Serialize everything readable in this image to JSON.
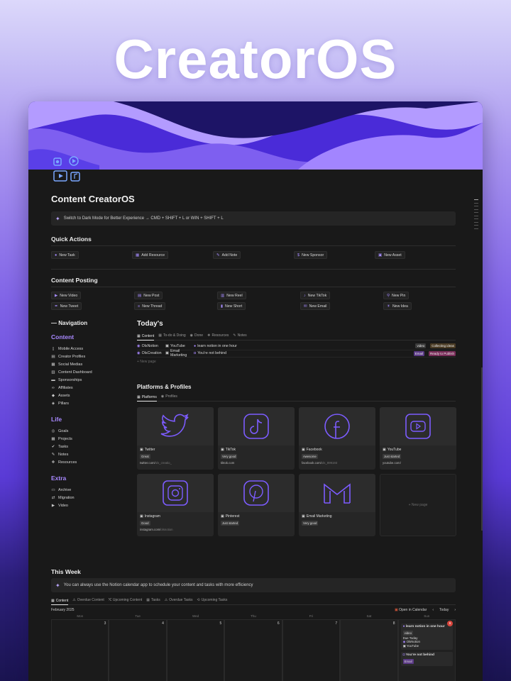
{
  "hero": {
    "title": "CreatorOS"
  },
  "page": {
    "title": "Content CreatorOS",
    "callout": "Switch to Dark Mode for Better Experience → CMD + SHIFT + L or WIN + SHIFT + L"
  },
  "quick_actions": {
    "heading": "Quick Actions",
    "items": [
      {
        "label": "New Task",
        "icon": "check-circle-icon"
      },
      {
        "label": "Add Resource",
        "icon": "grid-icon"
      },
      {
        "label": "Add Note",
        "icon": "pencil-icon"
      },
      {
        "label": "New Sponsor",
        "icon": "dollar-icon"
      },
      {
        "label": "New Asset",
        "icon": "image-icon"
      }
    ]
  },
  "content_posting": {
    "heading": "Content Posting",
    "items": [
      {
        "label": "New Video"
      },
      {
        "label": "New Post"
      },
      {
        "label": "New Reel"
      },
      {
        "label": "New TikTok"
      },
      {
        "label": "New Pin"
      },
      {
        "label": "New Tweet"
      },
      {
        "label": "New Thread"
      },
      {
        "label": "New Short"
      },
      {
        "label": "New Email"
      },
      {
        "label": "New Idea"
      }
    ]
  },
  "navigation": {
    "heading": "— Navigation",
    "sections": [
      {
        "title": "Content",
        "items": [
          "Mobile Access",
          "Creator Profiles",
          "Social Medias",
          "Content Dashboard",
          "Sponsorships",
          "Affiliates",
          "Assets",
          "Pillars"
        ]
      },
      {
        "title": "Life",
        "items": [
          "Goals",
          "Projects",
          "Tasks",
          "Notes",
          "Resources"
        ]
      },
      {
        "title": "Extra",
        "items": [
          "Archive",
          "Migration",
          "Video"
        ]
      }
    ]
  },
  "today": {
    "heading": "Today's",
    "tabs": [
      "Content",
      "To-do & Doing",
      "Done",
      "Resources",
      "Notes"
    ],
    "rows": [
      {
        "who": "OlsNotion",
        "platform": "YouTube",
        "title": "learn notion in one hour",
        "tags": [
          "video",
          "Collecting ideas"
        ]
      },
      {
        "who": "OlsCreation",
        "platform": "Email Marketing",
        "title": "You're not behind",
        "tags": [
          "Email",
          "Ready to Publish"
        ]
      }
    ],
    "new_page": "+ New page"
  },
  "platforms": {
    "heading": "Platforms & Profiles",
    "tabs": [
      "Platforms",
      "Profiles"
    ],
    "cards": [
      {
        "name": "Twitter",
        "status": "Great",
        "url": "twitter.com/",
        "url_muted": "ols_creatio_"
      },
      {
        "name": "TikTok",
        "status": "Very good",
        "url": "tiktok.com",
        "url_muted": ""
      },
      {
        "name": "Facebook",
        "status": "Awesome",
        "url": "facebook.com/",
        "url_muted": "ols_899193"
      },
      {
        "name": "YouTube",
        "status": "Just started",
        "url": "youtube.com/",
        "url_muted": ""
      },
      {
        "name": "Instagram",
        "status": "Good",
        "url": "instagram.com/",
        "url_muted": "olsnotion"
      },
      {
        "name": "Pinterest",
        "status": "Just started",
        "url": "",
        "url_muted": ""
      },
      {
        "name": "Email Marketing",
        "status": "Very good",
        "url": "",
        "url_muted": ""
      }
    ],
    "new_page": "+ New page"
  },
  "this_week": {
    "heading": "This Week",
    "callout": "You can always use the Notion calendar app to schedule your content and tasks with more efficiency",
    "tabs": [
      "Content",
      "Overdue Content",
      "Upcoming Content",
      "Tasks",
      "Overdue Tasks",
      "Upcoming Tasks"
    ],
    "month": "February 2025",
    "open_calendar": "Open in Calendar",
    "today": "Today",
    "days": [
      "Mon",
      "Tue",
      "Wed",
      "Thu",
      "Fri",
      "Sat",
      "Sun"
    ],
    "dates": [
      "3",
      "4",
      "5",
      "6",
      "7",
      "8",
      "9"
    ],
    "events": [
      {
        "title": "learn notion in one hour",
        "tag": "video",
        "note": "Due Today",
        "who": "OlsNotion",
        "platform": "YouTube"
      },
      {
        "title": "You're not behind",
        "tag": "Email"
      }
    ]
  },
  "colors": {
    "accent": "#a888ff",
    "window_bg": "#191919"
  }
}
